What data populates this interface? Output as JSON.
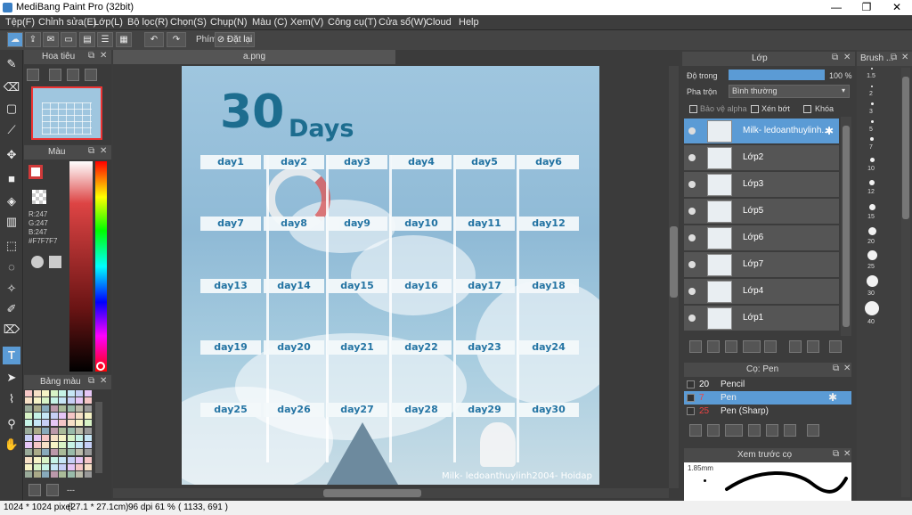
{
  "window": {
    "title": "MediBang Paint Pro (32bit)",
    "controls": [
      "—",
      "❐",
      "✕"
    ]
  },
  "menu": [
    "Tệp(F)",
    "Chỉnh sửa(E)",
    "Lớp(L)",
    "Bộ lọc(R)",
    "Chọn(S)",
    "Chụp(N)",
    "Màu (C)",
    "Xem(V)",
    "Công cụ(T)",
    "Cửa sổ(W)",
    "Cloud",
    "Help"
  ],
  "toolbar": {
    "phim_label": "Phím",
    "reset_label": "Đặt lại"
  },
  "navigator": {
    "title": "Hoa tiêu"
  },
  "color": {
    "title": "Màu",
    "r": "R:247",
    "g": "G:247",
    "b": "B:247",
    "hex": "#F7F7F7",
    "fg": "#f7f7f7",
    "accent": "#d03a3a"
  },
  "palette": {
    "title": "Bảng màu",
    "more": "---"
  },
  "document": {
    "tab": "a.png"
  },
  "artwork": {
    "heading_num": "30",
    "heading_word": "Days",
    "days": [
      "day1",
      "day2",
      "day3",
      "day4",
      "day5",
      "day6",
      "day7",
      "day8",
      "day9",
      "day10",
      "day11",
      "day12",
      "day13",
      "day14",
      "day15",
      "day16",
      "day17",
      "day18",
      "day19",
      "day20",
      "day21",
      "day22",
      "day23",
      "day24",
      "day25",
      "day26",
      "day27",
      "day28",
      "day29",
      "day30"
    ],
    "credit": "Milk- ledoanthuylinh2004- Hoidap"
  },
  "layers": {
    "title": "Lớp",
    "opacity_label": "Độ trong",
    "opacity_value": "100 %",
    "blend_label": "Pha trộn",
    "blend_value": "Bình thường",
    "protect_alpha": "Bảo vệ alpha",
    "clip": "Xén bớt",
    "lock": "Khóa",
    "items": [
      "Milk- ledoanthuylinh...",
      "Lớp2",
      "Lớp3",
      "Lớp5",
      "Lớp6",
      "Lớp7",
      "Lớp4",
      "Lớp1"
    ]
  },
  "brush_list": {
    "title": "Cọ: Pen",
    "items": [
      {
        "size": "20",
        "name": "Pencil"
      },
      {
        "size": "7",
        "name": "Pen"
      },
      {
        "size": "25",
        "name": "Pen (Sharp)"
      }
    ]
  },
  "preview": {
    "title": "Xem trước cọ",
    "size": "1.85mm"
  },
  "brush_sizes": {
    "title": "Brush ...",
    "values": [
      "1.5",
      "2",
      "3",
      "5",
      "7",
      "10",
      "12",
      "15",
      "20",
      "25",
      "30",
      "40"
    ]
  },
  "status": {
    "dimensions": "1024 * 1024 pixel",
    "size_cm": "(27.1 * 27.1cm)",
    "dpi": "96 dpi",
    "zoom": "61 %",
    "coords": "( 1133, 691 )"
  }
}
